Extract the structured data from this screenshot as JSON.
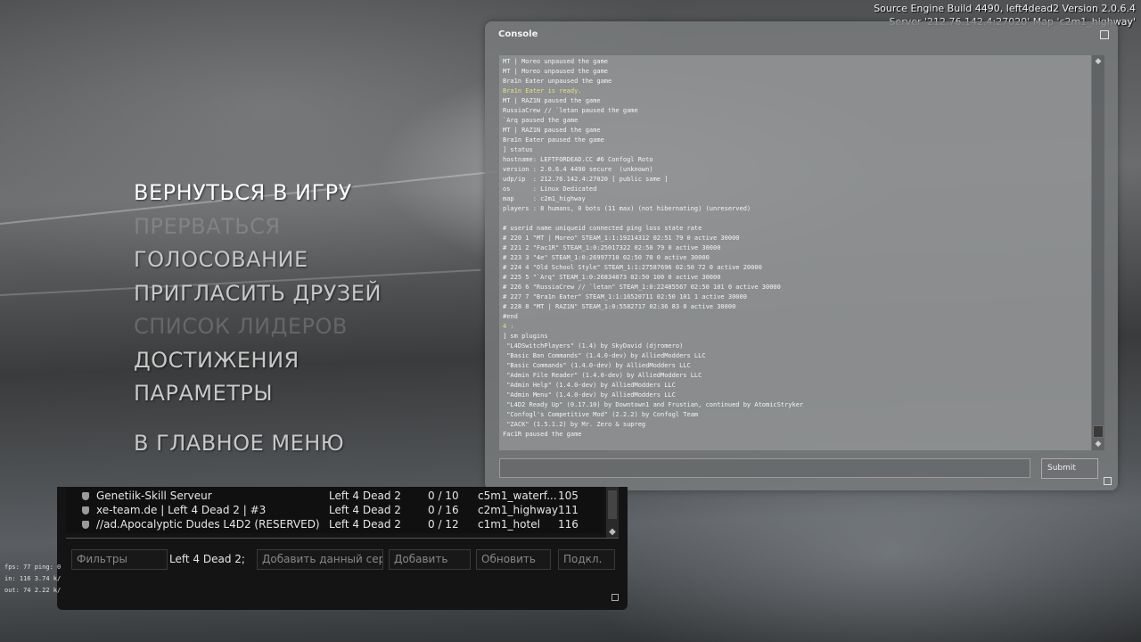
{
  "build_info": {
    "line1": "Source Engine Build 4490, left4dead2 Version 2.0.6.4",
    "line2": "Server '212.76.142.4:27020' Map 'c2m1_highway'"
  },
  "menu": {
    "items": [
      {
        "label": "ВЕРНУТЬСЯ В ИГРУ",
        "state": "active"
      },
      {
        "label": "ПРЕРВАТЬСЯ",
        "state": "disabled"
      },
      {
        "label": "ГОЛОСОВАНИЕ",
        "state": "normal"
      },
      {
        "label": "ПРИГЛАСИТЬ ДРУЗЕЙ",
        "state": "normal"
      },
      {
        "label": "СПИСОК ЛИДЕРОВ",
        "state": "disabled"
      },
      {
        "label": "ДОСТИЖЕНИЯ",
        "state": "normal"
      },
      {
        "label": "ПАРАМЕТРЫ",
        "state": "normal"
      },
      {
        "label": "В ГЛАВНОЕ МЕНЮ",
        "state": "normal"
      }
    ]
  },
  "console": {
    "title": "Console",
    "submit_label": "Submit",
    "highlight_color": "#e8e27a",
    "lines": [
      {
        "text": "MT | Moreo unpaused the game",
        "color": "normal"
      },
      {
        "text": "MT | Moreo unpaused the game",
        "color": "normal"
      },
      {
        "text": "Bra1n Eater unpaused the game",
        "color": "normal"
      },
      {
        "text": "Bra1n Eater is ready.",
        "color": "yellow"
      },
      {
        "text": "MT | RAZ1N paused the game",
        "color": "normal"
      },
      {
        "text": "RussiaCrew // `letan paused the game",
        "color": "normal"
      },
      {
        "text": "`Arq paused the game",
        "color": "normal"
      },
      {
        "text": "MT | RAZ1N paused the game",
        "color": "normal"
      },
      {
        "text": "Bra1n Eater paused the game",
        "color": "normal"
      },
      {
        "text": "] status",
        "color": "normal"
      },
      {
        "text": "hostname: LEFTFORDEAD.CC #6 Confogl Roto",
        "color": "normal"
      },
      {
        "text": "version : 2.0.6.4 4490 secure  (unknown)",
        "color": "normal"
      },
      {
        "text": "udp/ip  : 212.76.142.4:27020 [ public same ]",
        "color": "normal"
      },
      {
        "text": "os      : Linux Dedicated",
        "color": "normal"
      },
      {
        "text": "map     : c2m1_highway",
        "color": "normal"
      },
      {
        "text": "players : 8 humans, 0 bots (11 max) (not hibernating) (unreserved)",
        "color": "normal"
      },
      {
        "text": "",
        "color": "normal"
      },
      {
        "text": "# userid name uniqueid connected ping loss state rate",
        "color": "normal"
      },
      {
        "text": "# 220 1 \"MT | Moreo\" STEAM_1:1:19214312 02:51 79 0 active 30000",
        "color": "normal"
      },
      {
        "text": "# 221 2 \"Fac1R\" STEAM_1:0:25017322 02:50 79 0 active 30000",
        "color": "normal"
      },
      {
        "text": "# 223 3 \"4e\" STEAM_1:0:26997710 02:50 70 0 active 30000",
        "color": "normal"
      },
      {
        "text": "# 224 4 \"Old School Style\" STEAM_1:1:27587696 02:50 72 0 active 20000",
        "color": "normal"
      },
      {
        "text": "# 225 5 \"`Arq\" STEAM_1:0:26834073 02:50 100 0 active 30000",
        "color": "normal"
      },
      {
        "text": "# 226 6 \"RussiaCrew // `letan\" STEAM_1:0:22485567 02:50 101 0 active 30000",
        "color": "normal"
      },
      {
        "text": "# 227 7 \"Bra1n Eater\" STEAM_1:1:16520711 02:50 101 1 active 30000",
        "color": "normal"
      },
      {
        "text": "# 228 8 \"MT | RAZ1N\" STEAM_1:0:5582717 02:36 83 0 active 30000",
        "color": "normal"
      },
      {
        "text": "#end",
        "color": "normal"
      },
      {
        "text": "4 :",
        "color": "yellow"
      },
      {
        "text": "] sm plugins",
        "color": "normal"
      },
      {
        "text": " \"L4DSwitchPlayers\" (1.4) by SkyDavid (djromero)",
        "color": "normal"
      },
      {
        "text": " \"Basic Ban Commands\" (1.4.0-dev) by AlliedModders LLC",
        "color": "normal"
      },
      {
        "text": " \"Basic Commands\" (1.4.0-dev) by AlliedModders LLC",
        "color": "normal"
      },
      {
        "text": " \"Admin File Reader\" (1.4.0-dev) by AlliedModders LLC",
        "color": "normal"
      },
      {
        "text": " \"Admin Help\" (1.4.0-dev) by AlliedModders LLC",
        "color": "normal"
      },
      {
        "text": " \"Admin Menu\" (1.4.0-dev) by AlliedModders LLC",
        "color": "normal"
      },
      {
        "text": " \"L4D2 Ready Up\" (0.17.10) by Downtown1 and Frustian, continued by AtomicStryker",
        "color": "normal"
      },
      {
        "text": " \"Confogl's Competitive Mod\" (2.2.2) by Confogl Team",
        "color": "normal"
      },
      {
        "text": " \"ZACK\" (1.5.1.2) by Mr. Zero & supreg",
        "color": "normal"
      },
      {
        "text": "Fac1R paused the game",
        "color": "normal"
      }
    ]
  },
  "server_browser": {
    "servers": [
      {
        "name": "Genetiik-Skill Serveur",
        "game": "Left 4 Dead 2",
        "players": "0 / 10",
        "map": "c5m1_waterf...",
        "latency": "105"
      },
      {
        "name": "xe-team.de | Left 4 Dead 2 | #3",
        "game": "Left 4 Dead 2",
        "players": "0 / 16",
        "map": "c2m1_highway",
        "latency": "111"
      },
      {
        "name": "//ad.Apocalyptic Dudes L4D2 (RESERVED)",
        "game": "Left 4 Dead 2",
        "players": "0 / 12",
        "map": "c1m1_hotel",
        "latency": "116"
      }
    ],
    "filters_label": "Фильтры",
    "filter_value": "Left 4 Dead 2;",
    "add_current_label": "Добавить данный сер...",
    "add_label": "Добавить",
    "refresh_label": "Обновить",
    "connect_label": "Подкл."
  },
  "netgraph": {
    "line1": "fps:  77   ping: 0",
    "line2": "in:  116  3.74 k/",
    "line3": "out:  74  2.22 k/"
  }
}
